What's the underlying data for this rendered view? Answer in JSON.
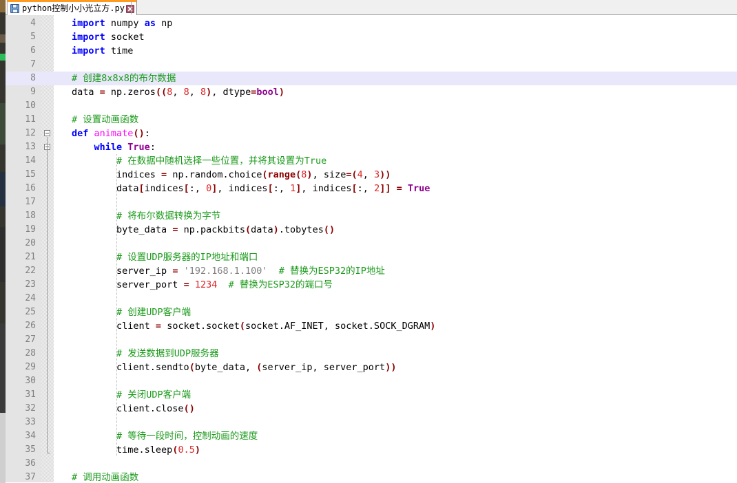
{
  "window": {
    "app_kind": "code-editor"
  },
  "tab": {
    "title": "python控制小小光立方.py",
    "save_icon": "floppy-disk-icon",
    "close_icon": "close-icon",
    "active": true
  },
  "editor": {
    "first_visible_line": 4,
    "last_visible_line": 37,
    "highlighted_line": 8,
    "colors": {
      "background": "#ffffff",
      "gutter": "#e4e4e4",
      "line_number": "#808080",
      "current_line_highlight": "#e8e8fa",
      "tab_accent": "#ff9b21",
      "keyword": "#0000ff",
      "builtin": "#8b0000",
      "comment": "#1a9a1a",
      "number": "#dd2222",
      "string": "#808080",
      "function": "#ff00ff",
      "operator": "#8b0000",
      "constant": "#900090"
    },
    "lines": [
      {
        "n": 4,
        "tokens": [
          {
            "t": "import",
            "c": "kw"
          },
          {
            "t": " numpy ",
            "c": ""
          },
          {
            "t": "as",
            "c": "kw"
          },
          {
            "t": " np",
            "c": ""
          }
        ]
      },
      {
        "n": 5,
        "tokens": [
          {
            "t": "import",
            "c": "kw"
          },
          {
            "t": " socket",
            "c": ""
          }
        ]
      },
      {
        "n": 6,
        "tokens": [
          {
            "t": "import",
            "c": "kw"
          },
          {
            "t": " time",
            "c": ""
          }
        ]
      },
      {
        "n": 7,
        "tokens": []
      },
      {
        "n": 8,
        "tokens": [
          {
            "t": "# 创建8x8x8的布尔数据",
            "c": "cm"
          }
        ]
      },
      {
        "n": 9,
        "tokens": [
          {
            "t": "data ",
            "c": ""
          },
          {
            "t": "=",
            "c": "op"
          },
          {
            "t": " np.zeros",
            "c": ""
          },
          {
            "t": "((",
            "c": "op"
          },
          {
            "t": "8",
            "c": "nu"
          },
          {
            "t": ", ",
            "c": ""
          },
          {
            "t": "8",
            "c": "nu"
          },
          {
            "t": ", ",
            "c": ""
          },
          {
            "t": "8",
            "c": "nu"
          },
          {
            "t": ")",
            "c": "op"
          },
          {
            "t": ", dtype",
            "c": ""
          },
          {
            "t": "=",
            "c": "op"
          },
          {
            "t": "bool",
            "c": "cn"
          },
          {
            "t": ")",
            "c": "op"
          }
        ]
      },
      {
        "n": 10,
        "tokens": []
      },
      {
        "n": 11,
        "tokens": [
          {
            "t": "# 设置动画函数",
            "c": "cm"
          }
        ]
      },
      {
        "n": 12,
        "tokens": [
          {
            "t": "def",
            "c": "kw"
          },
          {
            "t": " ",
            "c": ""
          },
          {
            "t": "animate",
            "c": "fn"
          },
          {
            "t": "()",
            "c": "op"
          },
          {
            "t": ":",
            "c": ""
          }
        ]
      },
      {
        "n": 13,
        "tokens": [
          {
            "t": "    ",
            "c": ""
          },
          {
            "t": "while",
            "c": "kw"
          },
          {
            "t": " ",
            "c": ""
          },
          {
            "t": "True",
            "c": "cn"
          },
          {
            "t": ":",
            "c": ""
          }
        ]
      },
      {
        "n": 14,
        "tokens": [
          {
            "t": "        # 在数据中随机选择一些位置，并将其设置为True",
            "c": "cm"
          }
        ]
      },
      {
        "n": 15,
        "tokens": [
          {
            "t": "        indices ",
            "c": ""
          },
          {
            "t": "=",
            "c": "op"
          },
          {
            "t": " np.random.choice",
            "c": ""
          },
          {
            "t": "(",
            "c": "op"
          },
          {
            "t": "range",
            "c": "bi"
          },
          {
            "t": "(",
            "c": "op"
          },
          {
            "t": "8",
            "c": "nu"
          },
          {
            "t": ")",
            "c": "op"
          },
          {
            "t": ", size",
            "c": ""
          },
          {
            "t": "=",
            "c": "op"
          },
          {
            "t": "(",
            "c": "op"
          },
          {
            "t": "4",
            "c": "nu"
          },
          {
            "t": ", ",
            "c": ""
          },
          {
            "t": "3",
            "c": "nu"
          },
          {
            "t": "))",
            "c": "op"
          }
        ]
      },
      {
        "n": 16,
        "tokens": [
          {
            "t": "        data",
            "c": ""
          },
          {
            "t": "[",
            "c": "op"
          },
          {
            "t": "indices",
            "c": ""
          },
          {
            "t": "[",
            "c": "op"
          },
          {
            "t": ":, ",
            "c": ""
          },
          {
            "t": "0",
            "c": "nu"
          },
          {
            "t": "]",
            "c": "op"
          },
          {
            "t": ", indices",
            "c": ""
          },
          {
            "t": "[",
            "c": "op"
          },
          {
            "t": ":, ",
            "c": ""
          },
          {
            "t": "1",
            "c": "nu"
          },
          {
            "t": "]",
            "c": "op"
          },
          {
            "t": ", indices",
            "c": ""
          },
          {
            "t": "[",
            "c": "op"
          },
          {
            "t": ":, ",
            "c": ""
          },
          {
            "t": "2",
            "c": "nu"
          },
          {
            "t": "]]",
            "c": "op"
          },
          {
            "t": " ",
            "c": ""
          },
          {
            "t": "=",
            "c": "op"
          },
          {
            "t": " ",
            "c": ""
          },
          {
            "t": "True",
            "c": "cn"
          }
        ]
      },
      {
        "n": 17,
        "tokens": []
      },
      {
        "n": 18,
        "tokens": [
          {
            "t": "        # 将布尔数据转换为字节",
            "c": "cm"
          }
        ]
      },
      {
        "n": 19,
        "tokens": [
          {
            "t": "        byte_data ",
            "c": ""
          },
          {
            "t": "=",
            "c": "op"
          },
          {
            "t": " np.packbits",
            "c": ""
          },
          {
            "t": "(",
            "c": "op"
          },
          {
            "t": "data",
            "c": ""
          },
          {
            "t": ")",
            "c": "op"
          },
          {
            "t": ".tobytes",
            "c": ""
          },
          {
            "t": "()",
            "c": "op"
          }
        ]
      },
      {
        "n": 20,
        "tokens": []
      },
      {
        "n": 21,
        "tokens": [
          {
            "t": "        # 设置UDP服务器的IP地址和端口",
            "c": "cm"
          }
        ]
      },
      {
        "n": 22,
        "tokens": [
          {
            "t": "        server_ip ",
            "c": ""
          },
          {
            "t": "=",
            "c": "op"
          },
          {
            "t": " ",
            "c": ""
          },
          {
            "t": "'192.168.1.100'",
            "c": "st"
          },
          {
            "t": "  ",
            "c": ""
          },
          {
            "t": "# 替换为ESP32的IP地址",
            "c": "cm"
          }
        ]
      },
      {
        "n": 23,
        "tokens": [
          {
            "t": "        server_port ",
            "c": ""
          },
          {
            "t": "=",
            "c": "op"
          },
          {
            "t": " ",
            "c": ""
          },
          {
            "t": "1234",
            "c": "nu"
          },
          {
            "t": "  ",
            "c": ""
          },
          {
            "t": "# 替换为ESP32的端口号",
            "c": "cm"
          }
        ]
      },
      {
        "n": 24,
        "tokens": []
      },
      {
        "n": 25,
        "tokens": [
          {
            "t": "        # 创建UDP客户端",
            "c": "cm"
          }
        ]
      },
      {
        "n": 26,
        "tokens": [
          {
            "t": "        client ",
            "c": ""
          },
          {
            "t": "=",
            "c": "op"
          },
          {
            "t": " socket.socket",
            "c": ""
          },
          {
            "t": "(",
            "c": "op"
          },
          {
            "t": "socket.AF_INET, socket.SOCK_DGRAM",
            "c": ""
          },
          {
            "t": ")",
            "c": "op"
          }
        ]
      },
      {
        "n": 27,
        "tokens": []
      },
      {
        "n": 28,
        "tokens": [
          {
            "t": "        # 发送数据到UDP服务器",
            "c": "cm"
          }
        ]
      },
      {
        "n": 29,
        "tokens": [
          {
            "t": "        client.sendto",
            "c": ""
          },
          {
            "t": "(",
            "c": "op"
          },
          {
            "t": "byte_data, ",
            "c": ""
          },
          {
            "t": "(",
            "c": "op"
          },
          {
            "t": "server_ip, server_port",
            "c": ""
          },
          {
            "t": "))",
            "c": "op"
          }
        ]
      },
      {
        "n": 30,
        "tokens": []
      },
      {
        "n": 31,
        "tokens": [
          {
            "t": "        # 关闭UDP客户端",
            "c": "cm"
          }
        ]
      },
      {
        "n": 32,
        "tokens": [
          {
            "t": "        client.close",
            "c": ""
          },
          {
            "t": "()",
            "c": "op"
          }
        ]
      },
      {
        "n": 33,
        "tokens": []
      },
      {
        "n": 34,
        "tokens": [
          {
            "t": "        # 等待一段时间，控制动画的速度",
            "c": "cm"
          }
        ]
      },
      {
        "n": 35,
        "tokens": [
          {
            "t": "        time.sleep",
            "c": ""
          },
          {
            "t": "(",
            "c": "op"
          },
          {
            "t": "0.5",
            "c": "nu"
          },
          {
            "t": ")",
            "c": "op"
          }
        ]
      },
      {
        "n": 36,
        "tokens": []
      },
      {
        "n": 37,
        "tokens": [
          {
            "t": "# 调用动画函数",
            "c": "cm"
          }
        ]
      }
    ],
    "fold_markers": [
      {
        "line": 12,
        "state": "expanded"
      },
      {
        "line": 13,
        "state": "expanded"
      }
    ]
  }
}
